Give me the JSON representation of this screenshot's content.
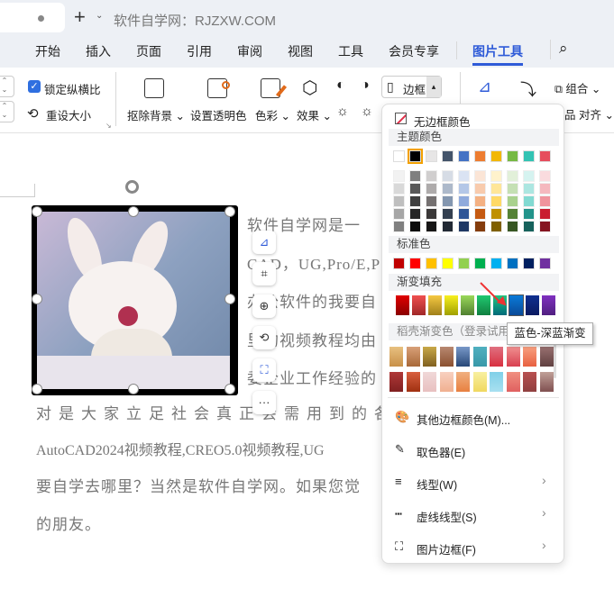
{
  "tabbar": {
    "site_title": "软件自学网：RJZXW.COM"
  },
  "menu": [
    "开始",
    "插入",
    "页面",
    "引用",
    "审阅",
    "视图",
    "工具",
    "会员专享",
    "图片工具"
  ],
  "ribbon": {
    "lock_ratio": "锁定纵横比",
    "reset_size": "重设大小",
    "remove_bg": "抠除背景",
    "set_transparent": "设置透明色",
    "color": "色彩",
    "effects": "效果",
    "border": "边框",
    "group": "组合",
    "align": "对齐"
  },
  "document": {
    "lines": [
      "软件自学网是一",
      "CAD，UG,Pro/E,P",
      "办公软件的我要自",
      "里的视频教程均由",
      "委企业工作经验的",
      "对是大家立足社会真正会需用到的各",
      "AutoCAD2024视频教程,CREO5.0视频教程,UG",
      "要自学去哪里？当然是软件自学网。如果您觉",
      "的朋友。"
    ]
  },
  "dropdown": {
    "no_border": "无边框颜色",
    "theme_label": "主题颜色",
    "theme_top": [
      "#ffffff",
      "#000000",
      "#e7e6e6",
      "#44546a",
      "#4472c4",
      "#ed7d31",
      "#f2b705",
      "#76b944",
      "#33c3b3",
      "#e64d5d"
    ],
    "theme_shades": [
      [
        "#f2f2f2",
        "#d9d9d9",
        "#bfbfbf",
        "#a6a6a6",
        "#808080"
      ],
      [
        "#7f7f7f",
        "#595959",
        "#3f3f3f",
        "#262626",
        "#0d0d0d"
      ],
      [
        "#d0cece",
        "#aeabab",
        "#757171",
        "#3a3838",
        "#171616"
      ],
      [
        "#d6dce5",
        "#adb9ca",
        "#8497b0",
        "#333f50",
        "#222a35"
      ],
      [
        "#dae3f3",
        "#b4c7e7",
        "#8faadc",
        "#2f5597",
        "#1f3864"
      ],
      [
        "#fbe5d6",
        "#f8cbad",
        "#f4b183",
        "#c55a11",
        "#843c0c"
      ],
      [
        "#fff2cc",
        "#ffe699",
        "#ffd966",
        "#bf9000",
        "#7f6000"
      ],
      [
        "#e2f0d9",
        "#c5e0b4",
        "#a9d18e",
        "#548235",
        "#385723"
      ],
      [
        "#d5f3f0",
        "#ace6e1",
        "#82dad2",
        "#22938a",
        "#17625c"
      ],
      [
        "#fadbde",
        "#f5b8be",
        "#f0949d",
        "#c91d30",
        "#861420"
      ]
    ],
    "standard_label": "标准色",
    "standard": [
      "#c00000",
      "#ff0000",
      "#ffc000",
      "#ffff00",
      "#92d050",
      "#00b050",
      "#00b0f0",
      "#0070c0",
      "#002060",
      "#7030a0"
    ],
    "gradient_label": "渐变填充",
    "gradient": [
      [
        "#e00000",
        "#8a0000"
      ],
      [
        "#f05050",
        "#a02828"
      ],
      [
        "#f5c842",
        "#a0801a"
      ],
      [
        "#f8f020",
        "#a0a000"
      ],
      [
        "#9ad85a",
        "#508030"
      ],
      [
        "#20c870",
        "#108040"
      ],
      [
        "#20c880",
        "#006a7a"
      ],
      [
        "#0a7ad8",
        "#0a4a98"
      ],
      [
        "#103090",
        "#0a1a60"
      ],
      [
        "#8030c0",
        "#502080"
      ]
    ],
    "shell_label": "稻壳渐变色（登录试用）",
    "shell": [
      [
        "#e8c080",
        "#c89048"
      ],
      [
        "#d8a078",
        "#a86838"
      ],
      [
        "#c8a848",
        "#806020"
      ],
      [
        "#b88870",
        "#8a5030"
      ],
      [
        "#7898c8",
        "#284878"
      ],
      [
        "#50b0c0",
        "#3898a8"
      ],
      [
        "#e07080",
        "#d83040"
      ],
      [
        "#f09090",
        "#d84050"
      ],
      [
        "#f8a080",
        "#e86040"
      ],
      [
        "#987070",
        "#604040"
      ],
      [
        "#b03838",
        "#802020"
      ],
      [
        "#d86040",
        "#a03010"
      ],
      [
        "#f0d8d8",
        "#e8c0c0"
      ],
      [
        "#f8d0c0",
        "#f0b090"
      ],
      [
        "#f0b080",
        "#e88040"
      ],
      [
        "#f8f0a0",
        "#f0d860"
      ],
      [
        "#80d0e8",
        "#a8e0f0"
      ],
      [
        "#f09080",
        "#e06060"
      ],
      [
        "#b85050",
        "#904040"
      ],
      [
        "#c0a098",
        "#805050"
      ]
    ],
    "tooltip": "蓝色-深蓝渐变",
    "items": [
      "其他边框颜色(M)...",
      "取色器(E)",
      "线型(W)",
      "虚线线型(S)",
      "图片边框(F)"
    ]
  }
}
